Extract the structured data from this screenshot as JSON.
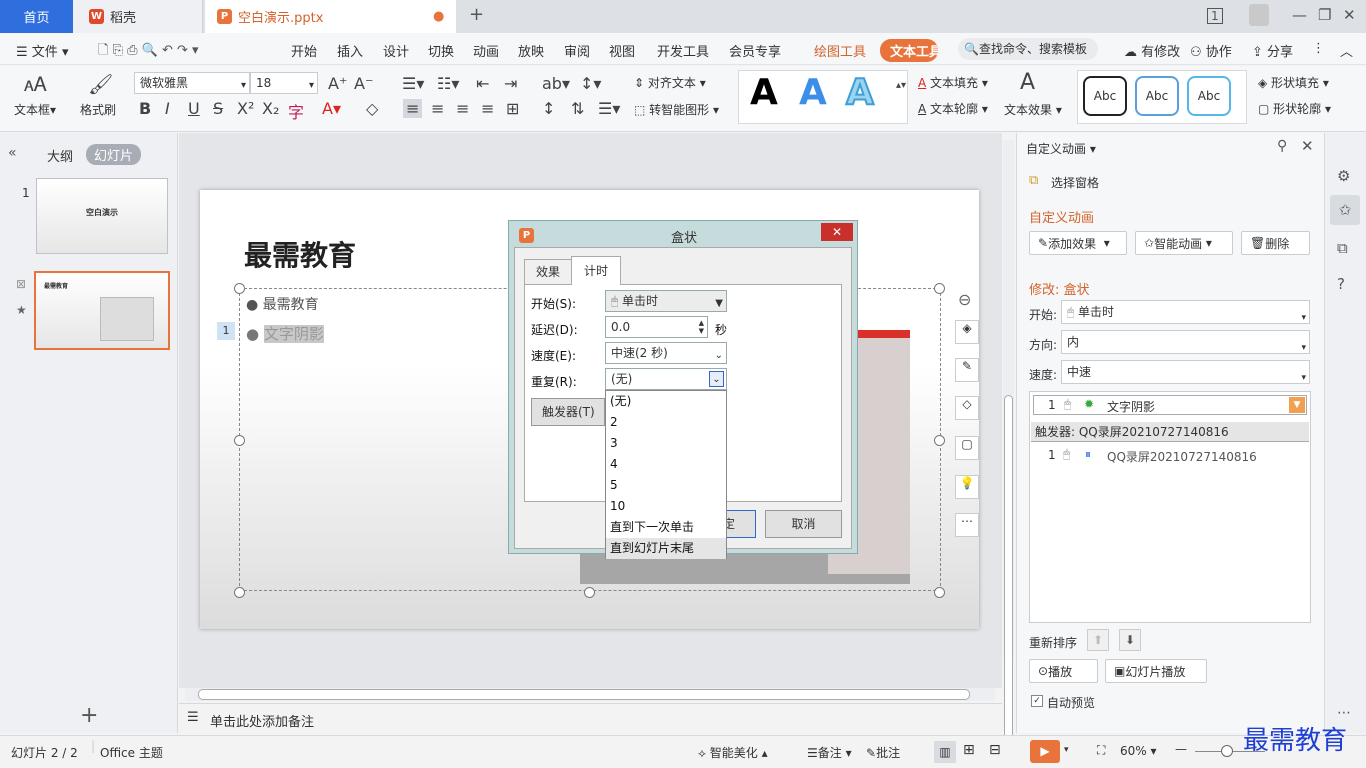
{
  "tabs": {
    "home": "首页",
    "daoke": "稻壳",
    "doc": "空白演示.pptx"
  },
  "menu": {
    "file": "文件",
    "start": "开始",
    "insert": "插入",
    "design": "设计",
    "transition": "切换",
    "animation": "动画",
    "slideshow": "放映",
    "review": "审阅",
    "view": "视图",
    "devtools": "开发工具",
    "member": "会员专享",
    "drawing": "绘图工具",
    "text_tool": "文本工具",
    "search": "查找命令、搜索模板",
    "has_changes": "有修改",
    "collab": "协作",
    "share": "分享"
  },
  "ribbon": {
    "textbox": "文本框",
    "format_painter": "格式刷",
    "font_name": "微软雅黑",
    "font_size": "18",
    "align_text": "对齐文本",
    "smart_shape": "转智能图形",
    "text_fill": "文本填充",
    "text_outline": "文本轮廓",
    "text_effect": "文本效果",
    "abc": "Abc",
    "shape_fill": "形状填充",
    "shape_outline": "形状轮廓"
  },
  "leftpanel": {
    "outline": "大纲",
    "slides": "幻灯片",
    "slide1_num": "1",
    "slide2_num": "2",
    "thumb1_title": "空白演示",
    "thumb2_title": "最需教育"
  },
  "slide": {
    "title": "最需教育",
    "bullet1": "最需教育",
    "bullet2": "文字阴影",
    "anim_tag": "1"
  },
  "dialog": {
    "title": "盒状",
    "tab_effect": "效果",
    "tab_timing": "计时",
    "start_label": "开始(S):",
    "start_value": "单击时",
    "delay_label": "延迟(D):",
    "delay_value": "0.0",
    "delay_unit": "秒",
    "speed_label": "速度(E):",
    "speed_value": "中速(2 秒)",
    "repeat_label": "重复(R):",
    "repeat_value": "(无)",
    "trigger_button": "触发器(T)",
    "ok_button": "确定",
    "cancel_button": "取消",
    "repeat_options": [
      "(无)",
      "2",
      "3",
      "4",
      "5",
      "10",
      "直到下一次单击",
      "直到幻灯片末尾"
    ]
  },
  "rightpanel": {
    "header": "自定义动画",
    "select_pane": "选择窗格",
    "section_title": "自定义动画",
    "add_effect": "添加效果",
    "smart_anim": "智能动画",
    "delete": "删除",
    "modify_title": "修改: 盒状",
    "start_label": "开始:",
    "start_value": "单击时",
    "direction_label": "方向:",
    "direction_value": "内",
    "speed_label": "速度:",
    "speed_value": "中速",
    "item1_num": "1",
    "item1_name": "文字阴影",
    "trigger_header": "触发器: QQ录屏20210727140816",
    "item2_num": "1",
    "item2_name": "QQ录屏20210727140816",
    "reorder": "重新排序",
    "play": "播放",
    "slideshow": "幻灯片播放",
    "auto_preview": "自动预览"
  },
  "notes": {
    "placeholder": "单击此处添加备注"
  },
  "status": {
    "slide_info": "幻灯片 2 / 2",
    "theme": "Office 主题",
    "smart_beauty": "智能美化",
    "notes": "备注",
    "comments": "批注",
    "zoom": "60%"
  },
  "watermark": "最需教育",
  "colors": {
    "accent": "#2f6fdd",
    "orange": "#d4632a"
  }
}
